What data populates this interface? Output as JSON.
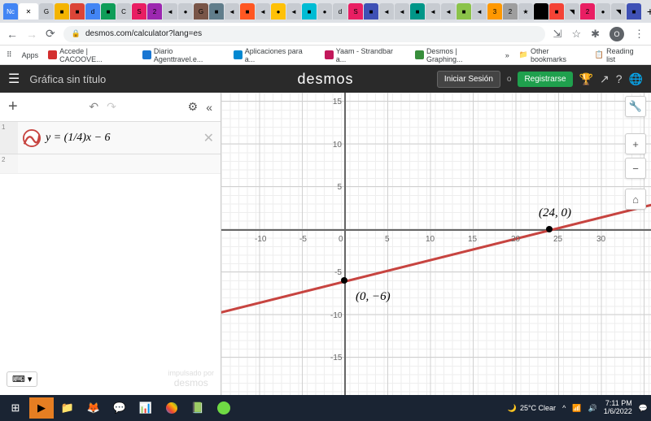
{
  "chrome": {
    "url": "desmos.com/calculator?lang=es",
    "bookmarks": [
      "Accede | CACOOVE...",
      "Diario Agenttravel.e...",
      "Aplicaciones para a...",
      "Yaam - Strandbar a...",
      "Desmos | Graphing..."
    ],
    "apps": "Apps",
    "other": "Other bookmarks",
    "reading": "Reading list"
  },
  "header": {
    "title": "Gráfica sin título",
    "logo": "desmos",
    "login": "Iniciar Sesión",
    "or": "o",
    "register": "Registrarse"
  },
  "panel": {
    "expr1_num": "1",
    "expr2_num": "2",
    "expression": "y = (1/4)x − 6",
    "watermark_top": "impulsado por",
    "watermark": "desmos"
  },
  "chart_data": {
    "type": "line",
    "equation": "y = (1/4)x - 6",
    "slope": 0.25,
    "intercept": -6,
    "points": [
      {
        "x": 0,
        "y": -6,
        "label": "(0, −6)"
      },
      {
        "x": 24,
        "y": 0,
        "label": "(24, 0)"
      }
    ],
    "xlim": [
      -14,
      34
    ],
    "ylim": [
      -18,
      16
    ],
    "xticks": [
      -10,
      -5,
      0,
      5,
      10,
      15,
      20,
      25,
      30
    ],
    "yticks": [
      -15,
      -10,
      -5,
      5,
      10,
      15
    ],
    "grid": true
  },
  "graph": {
    "label1": "(0, −6)",
    "label2": "(24, 0)",
    "xt": {
      "n10": "-10",
      "n5": "-5",
      "0": "0",
      "5": "5",
      "10": "10",
      "15": "15",
      "20": "20",
      "25": "25",
      "30": "30"
    },
    "yt": {
      "15": "15",
      "10": "10",
      "5": "5",
      "n5": "-5",
      "n10": "-10",
      "n15": "-15"
    }
  },
  "taskbar": {
    "weather": "25°C Clear",
    "time": "7:11 PM",
    "date": "1/6/2022"
  }
}
